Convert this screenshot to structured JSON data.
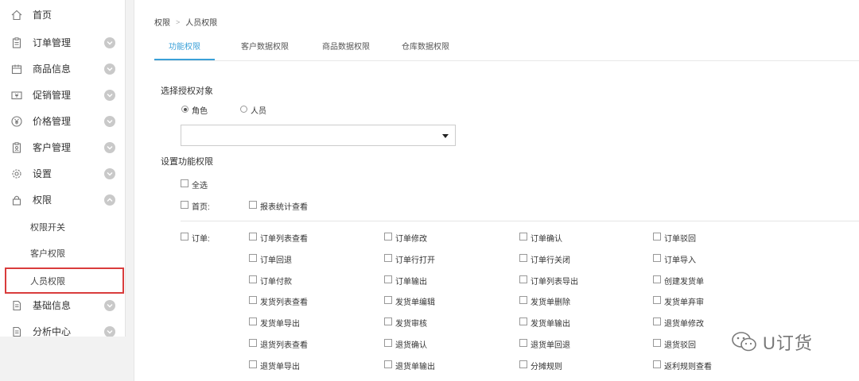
{
  "sidebar": {
    "items": [
      {
        "label": "首页",
        "icon": "home-icon"
      },
      {
        "label": "订单管理",
        "icon": "clipboard-icon"
      },
      {
        "label": "商品信息",
        "icon": "box-icon"
      },
      {
        "label": "促销管理",
        "icon": "coupon-icon"
      },
      {
        "label": "价格管理",
        "icon": "yen-icon"
      },
      {
        "label": "客户管理",
        "icon": "customer-icon"
      },
      {
        "label": "设置",
        "icon": "gear-icon"
      },
      {
        "label": "权限",
        "icon": "lock-icon"
      },
      {
        "label": "基础信息",
        "icon": "document-icon"
      },
      {
        "label": "分析中心",
        "icon": "document-icon"
      }
    ],
    "subitems": [
      "权限开关",
      "客户权限",
      "人员权限"
    ]
  },
  "breadcrumb": {
    "parent": "权限",
    "separator": ">",
    "current": "人员权限"
  },
  "tabs": [
    "功能权限",
    "客户数据权限",
    "商品数据权限",
    "仓库数据权限"
  ],
  "auth_target": {
    "title": "选择授权对象",
    "options": [
      "角色",
      "人员"
    ],
    "selected": "角色",
    "select_value": ""
  },
  "permissions": {
    "title": "设置功能权限",
    "select_all": "全选",
    "homepage": {
      "label": "首页:",
      "items": [
        "报表统计查看"
      ]
    },
    "order": {
      "label": "订单:",
      "rows": [
        [
          "订单列表查看",
          "订单修改",
          "订单确认",
          "订单驳回"
        ],
        [
          "订单回退",
          "订单行打开",
          "订单行关闭",
          "订单导入"
        ],
        [
          "订单付款",
          "订单输出",
          "订单列表导出",
          "创建发货单"
        ],
        [
          "发货列表查看",
          "发货单编辑",
          "发货单删除",
          "发货单弃审"
        ],
        [
          "发货单导出",
          "发货审核",
          "发货单输出",
          "退货单修改"
        ],
        [
          "退货列表查看",
          "退货确认",
          "退货单回退",
          "退货驳回"
        ],
        [
          "退货单导出",
          "退货单输出",
          "分摊规则",
          "返利规则查看"
        ]
      ]
    }
  },
  "watermark": {
    "text": "U订货"
  }
}
